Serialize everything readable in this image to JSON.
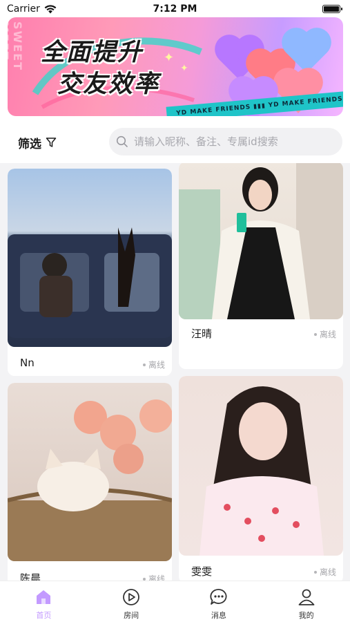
{
  "status_bar": {
    "carrier": "Carrier",
    "time": "7:12 PM"
  },
  "banner": {
    "title_line1": "全面提升",
    "title_line2": "交友效率",
    "side_text": "SWEET MEET",
    "ribbon_texts": [
      "YD MAKE FRIENDS",
      "YD MAKE FRIENDS"
    ]
  },
  "filter": {
    "label": "筛选"
  },
  "search": {
    "placeholder": "请输入昵称、备注、专属id搜索"
  },
  "cards": [
    {
      "name": "Nn",
      "status": "离线"
    },
    {
      "name": "汪晴",
      "status": "离线"
    },
    {
      "name": "陈晨",
      "status": "离线"
    },
    {
      "name": "雯雯",
      "status": "离线"
    }
  ],
  "tabs": [
    {
      "label": "首页",
      "icon": "home-icon",
      "active": true
    },
    {
      "label": "房间",
      "icon": "play-icon",
      "active": false
    },
    {
      "label": "消息",
      "icon": "chat-icon",
      "active": false
    },
    {
      "label": "我的",
      "icon": "profile-icon",
      "active": false
    }
  ],
  "colors": {
    "accent": "#c39aff",
    "offline": "#a6a6aa"
  }
}
